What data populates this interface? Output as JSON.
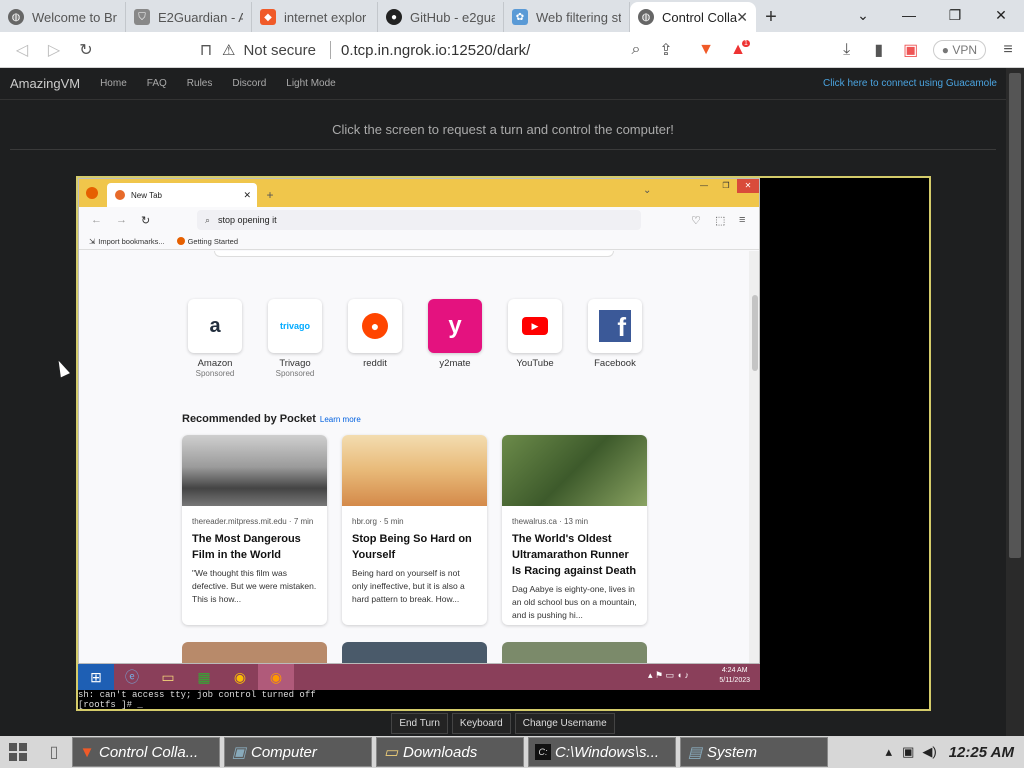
{
  "browser": {
    "tabs": [
      {
        "label": "Welcome to Br",
        "icon": "globe-icon"
      },
      {
        "label": "E2Guardian - A",
        "icon": "shield-icon"
      },
      {
        "label": "internet explor",
        "icon": "brave-icon"
      },
      {
        "label": "GitHub - e2gua",
        "icon": "github-icon"
      },
      {
        "label": "Web filtering st",
        "icon": "network-icon"
      },
      {
        "label": "Control Colla",
        "icon": "globe-icon"
      }
    ],
    "url": "0.tcp.in.ngrok.io:12520/dark/",
    "not_secure": "Not secure",
    "vpn_label": "VPN",
    "rewards_badge": "1"
  },
  "site": {
    "brand": "AmazingVM",
    "nav": [
      "Home",
      "FAQ",
      "Rules",
      "Discord",
      "Light Mode"
    ],
    "guac_link": "Click here to connect using Guacamole",
    "request_msg": "Click the screen to request a turn and control the computer!",
    "buttons": [
      "End Turn",
      "Keyboard",
      "Change Username"
    ]
  },
  "remote": {
    "tab_label": "New Tab",
    "search_text": "stop opening it",
    "bookmarks": [
      "Import bookmarks...",
      "Getting Started"
    ],
    "tiles": [
      {
        "name": "Amazon",
        "sponsored": "Sponsored",
        "color": "#232f3e"
      },
      {
        "name": "Trivago",
        "sponsored": "Sponsored",
        "color": "#00aaff"
      },
      {
        "name": "reddit",
        "sponsored": "",
        "color": "#ff4500"
      },
      {
        "name": "y2mate",
        "sponsored": "",
        "color": "#e4127f"
      },
      {
        "name": "YouTube",
        "sponsored": "",
        "color": "#ff0000"
      },
      {
        "name": "Facebook",
        "sponsored": "",
        "color": "#3b5998"
      }
    ],
    "recommended_title": "Recommended by Pocket",
    "learn_more": "Learn more",
    "cards": [
      {
        "source": "thereader.mitpress.mit.edu · 7 min",
        "title": "The Most Dangerous Film in the World",
        "excerpt": "\"We thought this film was defective. But we were mistaken. This is how..."
      },
      {
        "source": "hbr.org · 5 min",
        "title": "Stop Being So Hard on Yourself",
        "excerpt": "Being hard on yourself is not only ineffective, but it is also a hard pattern to break. How..."
      },
      {
        "source": "thewalrus.ca · 13 min",
        "title": "The World's Oldest Ultramarathon Runner Is Racing against Death",
        "excerpt": "Dag Aabye is eighty-one, lives in an old school bus on a mountain, and is pushing hi..."
      }
    ],
    "clock_time": "4:24 AM",
    "clock_date": "5/11/2023",
    "terminal": [
      "sh: can't access tty; job control turned off",
      "[rootfs ]# _"
    ]
  },
  "taskbar": {
    "items": [
      {
        "label": "Control Colla...",
        "icon": "brave-icon"
      },
      {
        "label": "Computer",
        "icon": "computer-icon"
      },
      {
        "label": "Downloads",
        "icon": "folder-icon"
      },
      {
        "label": "C:\\Windows\\s...",
        "icon": "cmd-icon"
      },
      {
        "label": "System",
        "icon": "system-icon"
      }
    ],
    "clock": "12:25 AM"
  }
}
